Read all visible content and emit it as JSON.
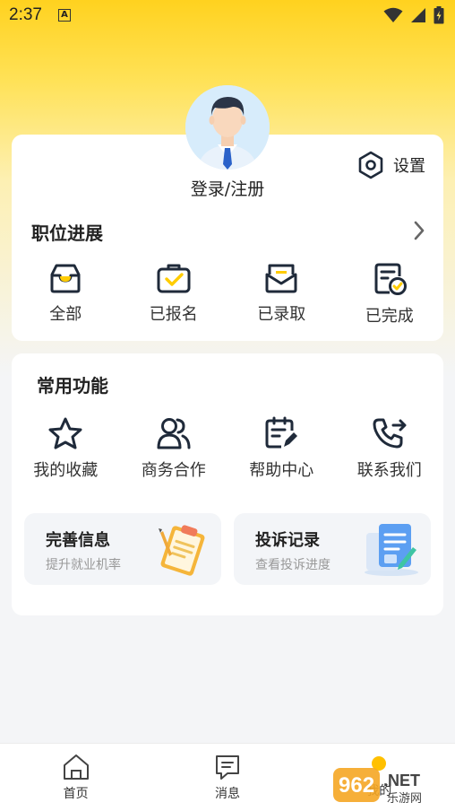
{
  "status_bar": {
    "time": "2:37",
    "notification_icon": "a-notification-icon",
    "wifi_icon": "wifi-icon",
    "signal_icon": "signal-icon",
    "battery_icon": "battery-icon"
  },
  "colors": {
    "accent": "#ffd21f",
    "nav_dot": "#ffc000",
    "icon_stroke": "#1f2a3a",
    "check_yellow": "#ffcc00"
  },
  "profile": {
    "avatar_icon": "user-avatar-icon",
    "login_label": "登录/注册",
    "settings_label": "设置"
  },
  "progress": {
    "title": "职位进展",
    "items": [
      {
        "label": "全部",
        "icon": "inbox-icon"
      },
      {
        "label": "已报名",
        "icon": "briefcase-check-icon"
      },
      {
        "label": "已录取",
        "icon": "envelope-icon"
      },
      {
        "label": "已完成",
        "icon": "document-check-icon"
      }
    ]
  },
  "functions": {
    "title": "常用功能",
    "items": [
      {
        "label": "我的收藏",
        "icon": "star-icon"
      },
      {
        "label": "商务合作",
        "icon": "users-icon"
      },
      {
        "label": "帮助中心",
        "icon": "calendar-edit-icon"
      },
      {
        "label": "联系我们",
        "icon": "phone-forward-icon"
      }
    ],
    "promos": [
      {
        "title": "完善信息",
        "subtitle": "提升就业机率",
        "icon": "clipboard-illustration"
      },
      {
        "title": "投诉记录",
        "subtitle": "查看投诉进度",
        "icon": "document-illustration"
      }
    ]
  },
  "bottom_nav": {
    "items": [
      {
        "label": "首页",
        "icon": "home-icon"
      },
      {
        "label": "消息",
        "icon": "message-icon"
      },
      {
        "label": "我的",
        "icon": "profile-dot-icon"
      }
    ]
  },
  "watermark": {
    "brand": "962.NET",
    "sub": "乐游网"
  }
}
